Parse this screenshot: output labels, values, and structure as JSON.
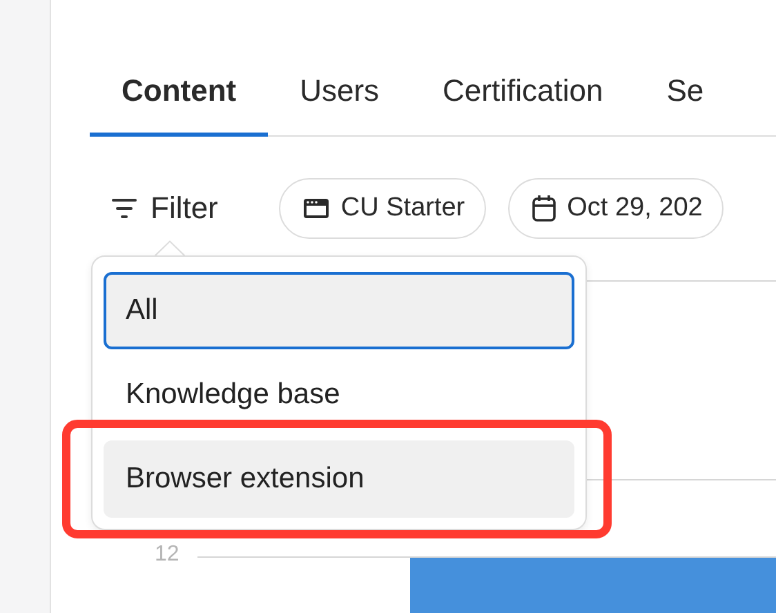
{
  "tabs": [
    {
      "label": "Content",
      "selected": true
    },
    {
      "label": "Users",
      "selected": false
    },
    {
      "label": "Certification",
      "selected": false
    },
    {
      "label": "Se",
      "selected": false
    }
  ],
  "filter": {
    "label": "Filter",
    "expanded": true
  },
  "chips": [
    {
      "kind": "product",
      "label": "CU Starter"
    },
    {
      "kind": "date",
      "label": "Oct 29, 202"
    }
  ],
  "filter_menu": {
    "items": [
      {
        "label": "All",
        "selected": true,
        "hovered": false,
        "callout": false
      },
      {
        "label": "Knowledge base",
        "selected": false,
        "hovered": false,
        "callout": false
      },
      {
        "label": "Browser extension",
        "selected": false,
        "hovered": true,
        "callout": true
      }
    ]
  },
  "chart": {
    "tick_label": "12"
  }
}
